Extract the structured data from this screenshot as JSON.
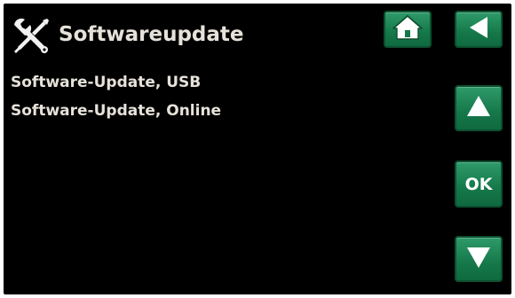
{
  "header": {
    "title": "Softwareupdate",
    "icon": "tools-icon"
  },
  "nav": {
    "home_icon": "home-icon",
    "back_icon": "back-arrow-icon",
    "up_icon": "up-arrow-icon",
    "ok_label": "OK",
    "down_icon": "down-arrow-icon"
  },
  "menu": {
    "items": [
      {
        "label": "Software-Update, USB"
      },
      {
        "label": "Software-Update, Online"
      }
    ]
  },
  "colors": {
    "background": "#000000",
    "text": "#e6e2da",
    "button": "#15784a",
    "button_border": "#0c4f2f",
    "icon": "#ffffff"
  }
}
